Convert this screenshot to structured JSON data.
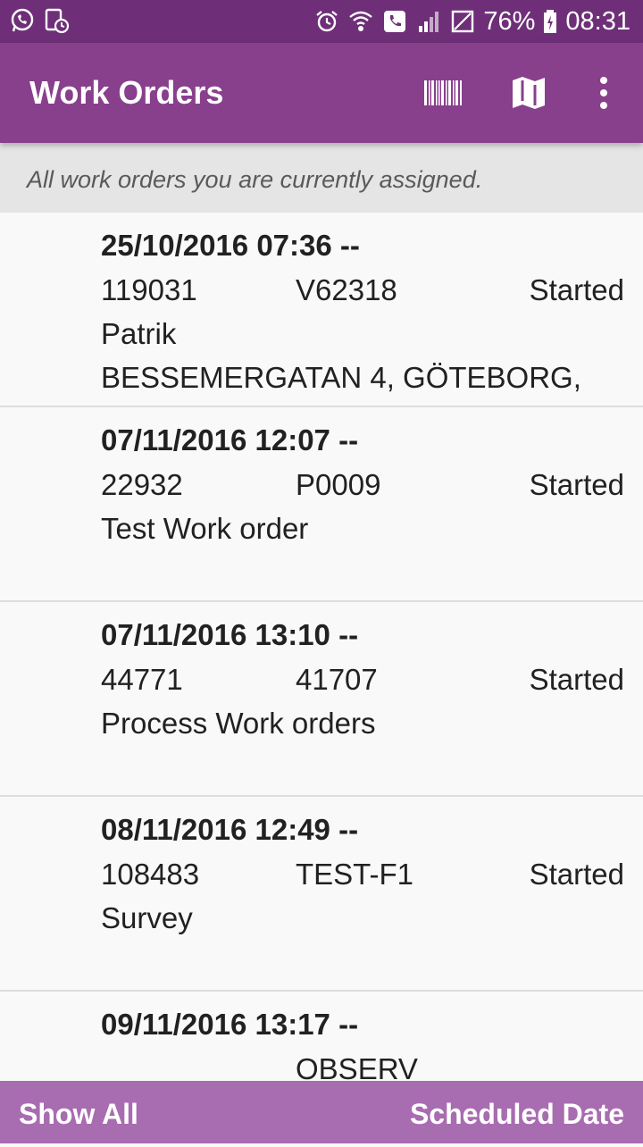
{
  "status_bar": {
    "left_icons": [
      "whatsapp-icon",
      "device-clock-icon"
    ],
    "right_icons": [
      "alarm-icon",
      "wifi-call-icon",
      "phone-call-icon",
      "signal-icon",
      "no-sim-icon",
      "battery-charging-icon"
    ],
    "battery": "76%",
    "time": "08:31"
  },
  "app_bar": {
    "title": "Work Orders",
    "actions": [
      "barcode-icon",
      "map-icon",
      "more-vert-icon"
    ]
  },
  "subtitle": "All work orders you are currently assigned.",
  "orders": [
    {
      "when": "25/10/2016 07:36 --",
      "number": "119031",
      "code": "V62318",
      "status": "Started",
      "description": "Patrik",
      "address": "BESSEMERGATAN 4, GÖTEBORG,"
    },
    {
      "when": "07/11/2016 12:07 --",
      "number": "22932",
      "code": "P0009",
      "status": "Started",
      "description": "Test Work order",
      "address": ""
    },
    {
      "when": "07/11/2016 13:10 --",
      "number": "44771",
      "code": "41707",
      "status": "Started",
      "description": "Process Work orders",
      "address": ""
    },
    {
      "when": "08/11/2016 12:49 --",
      "number": "108483",
      "code": "TEST-F1",
      "status": "Started",
      "description": "Survey",
      "address": ""
    },
    {
      "when": "09/11/2016 13:17 --",
      "number": "",
      "code": "OBSERV",
      "status": "",
      "description": "",
      "address": ""
    }
  ],
  "bottom_bar": {
    "show_all": "Show All",
    "sort": "Scheduled Date"
  },
  "colors": {
    "status_bar": "#6e2f78",
    "app_bar": "#883f8c",
    "bottom_bar": "#a86cb0",
    "subtitle_bg": "#e5e5e5"
  }
}
